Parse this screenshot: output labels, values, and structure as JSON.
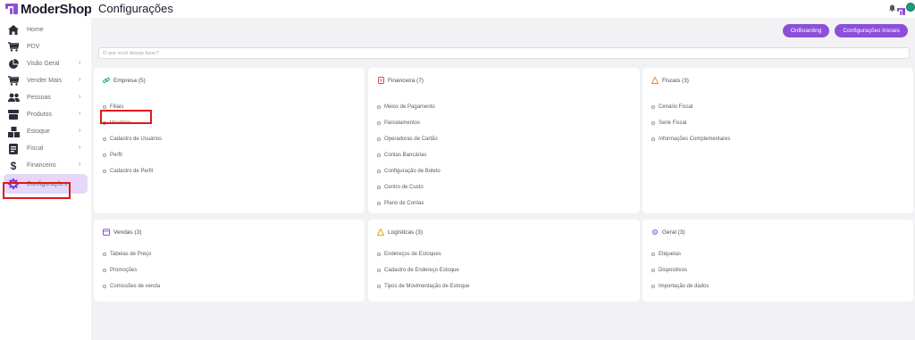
{
  "brand": {
    "name": "ModerShop"
  },
  "sidebar": {
    "items": [
      {
        "label": "Home",
        "icon": "home-icon",
        "chevron": false
      },
      {
        "label": "PDV",
        "icon": "cart-icon",
        "chevron": false
      },
      {
        "label": "Visão Geral",
        "icon": "pie-chart-icon",
        "chevron": true
      },
      {
        "label": "Vender Mais",
        "icon": "cart-plus-icon",
        "chevron": true
      },
      {
        "label": "Pessoas",
        "icon": "people-icon",
        "chevron": true
      },
      {
        "label": "Produtos",
        "icon": "box-icon",
        "chevron": true
      },
      {
        "label": "Estoque",
        "icon": "boxes-icon",
        "chevron": true
      },
      {
        "label": "Fiscal",
        "icon": "document-icon",
        "chevron": true
      },
      {
        "label": "Financeiro",
        "icon": "dollar-icon",
        "chevron": true
      },
      {
        "label": "Configurações",
        "icon": "gear-icon",
        "chevron": false,
        "active": true
      }
    ],
    "chevron_glyph": "›"
  },
  "header": {
    "title": "Configurações"
  },
  "actions": {
    "onboarding": "OnBoarding",
    "initial_settings": "Configurações Iniciais"
  },
  "search": {
    "placeholder": "O que você deseja fazer?"
  },
  "cards": {
    "empresa": {
      "title": "Empresa (5)",
      "icon_color": "#22a06b",
      "items": [
        "Filiais",
        "Usuários",
        "Cadastro de Usuários",
        "Perfil",
        "Cadastro de Perfil"
      ]
    },
    "financeira": {
      "title": "Financeira (7)",
      "icon_color": "#e0474c",
      "items": [
        "Meios de Pagamento",
        "Parcelamentos",
        "Operadoras de Cartão",
        "Contas Bancárias",
        "Configuração de Boleto",
        "Centro de Custo",
        "Plano de Contas"
      ]
    },
    "fiscais": {
      "title": "Fiscais (3)",
      "icon_color": "#f08a3c",
      "items": [
        "Cenário Fiscal",
        "Serie Fiscal",
        "Informações Complementares"
      ]
    },
    "vendas": {
      "title": "Vendas (3)",
      "icon_color": "#8c4fd8",
      "items": [
        "Tabelas de Preço",
        "Promoções",
        "Comissões de venda"
      ]
    },
    "logisticas": {
      "title": "Logísticas (3)",
      "icon_color": "#e6a520",
      "items": [
        "Endereços de Estoques",
        "Cadastro de Endereço Estoque",
        "Tipos de Movimentação de Estoque"
      ]
    },
    "geral": {
      "title": "Geral (3)",
      "icon_color": "#8c4fd8",
      "items": [
        "Etiquetas",
        "Dispositivos",
        "Importação de dados"
      ]
    }
  },
  "colors": {
    "accent": "#8c4fd8",
    "highlight": "#e01919",
    "active_bg": "#e6d7f8"
  }
}
